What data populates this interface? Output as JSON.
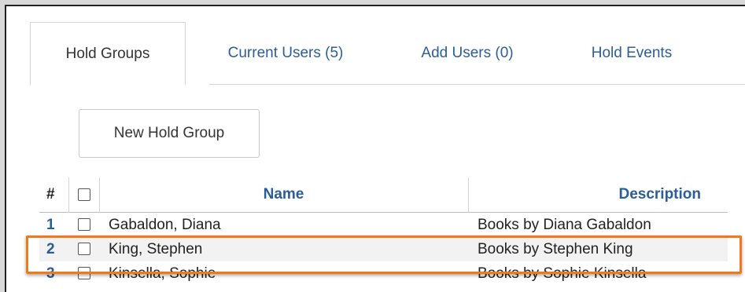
{
  "tabs": [
    {
      "label": "Hold Groups",
      "active": true
    },
    {
      "label": "Current Users (5)",
      "active": false
    },
    {
      "label": "Add Users (0)",
      "active": false
    },
    {
      "label": "Hold Events",
      "active": false
    }
  ],
  "new_button_label": "New Hold Group",
  "table": {
    "headers": {
      "num": "#",
      "name": "Name",
      "description": "Description"
    },
    "rows": [
      {
        "num": "1",
        "name": "Gabaldon, Diana",
        "description": "Books by Diana Gabaldon"
      },
      {
        "num": "2",
        "name": "King, Stephen",
        "description": "Books by Stephen King"
      },
      {
        "num": "3",
        "name": "Kinsella, Sophie",
        "description": "Books by Sophie Kinsella"
      }
    ]
  },
  "colors": {
    "link": "#2b5d96",
    "highlight": "#ef7a1a"
  }
}
